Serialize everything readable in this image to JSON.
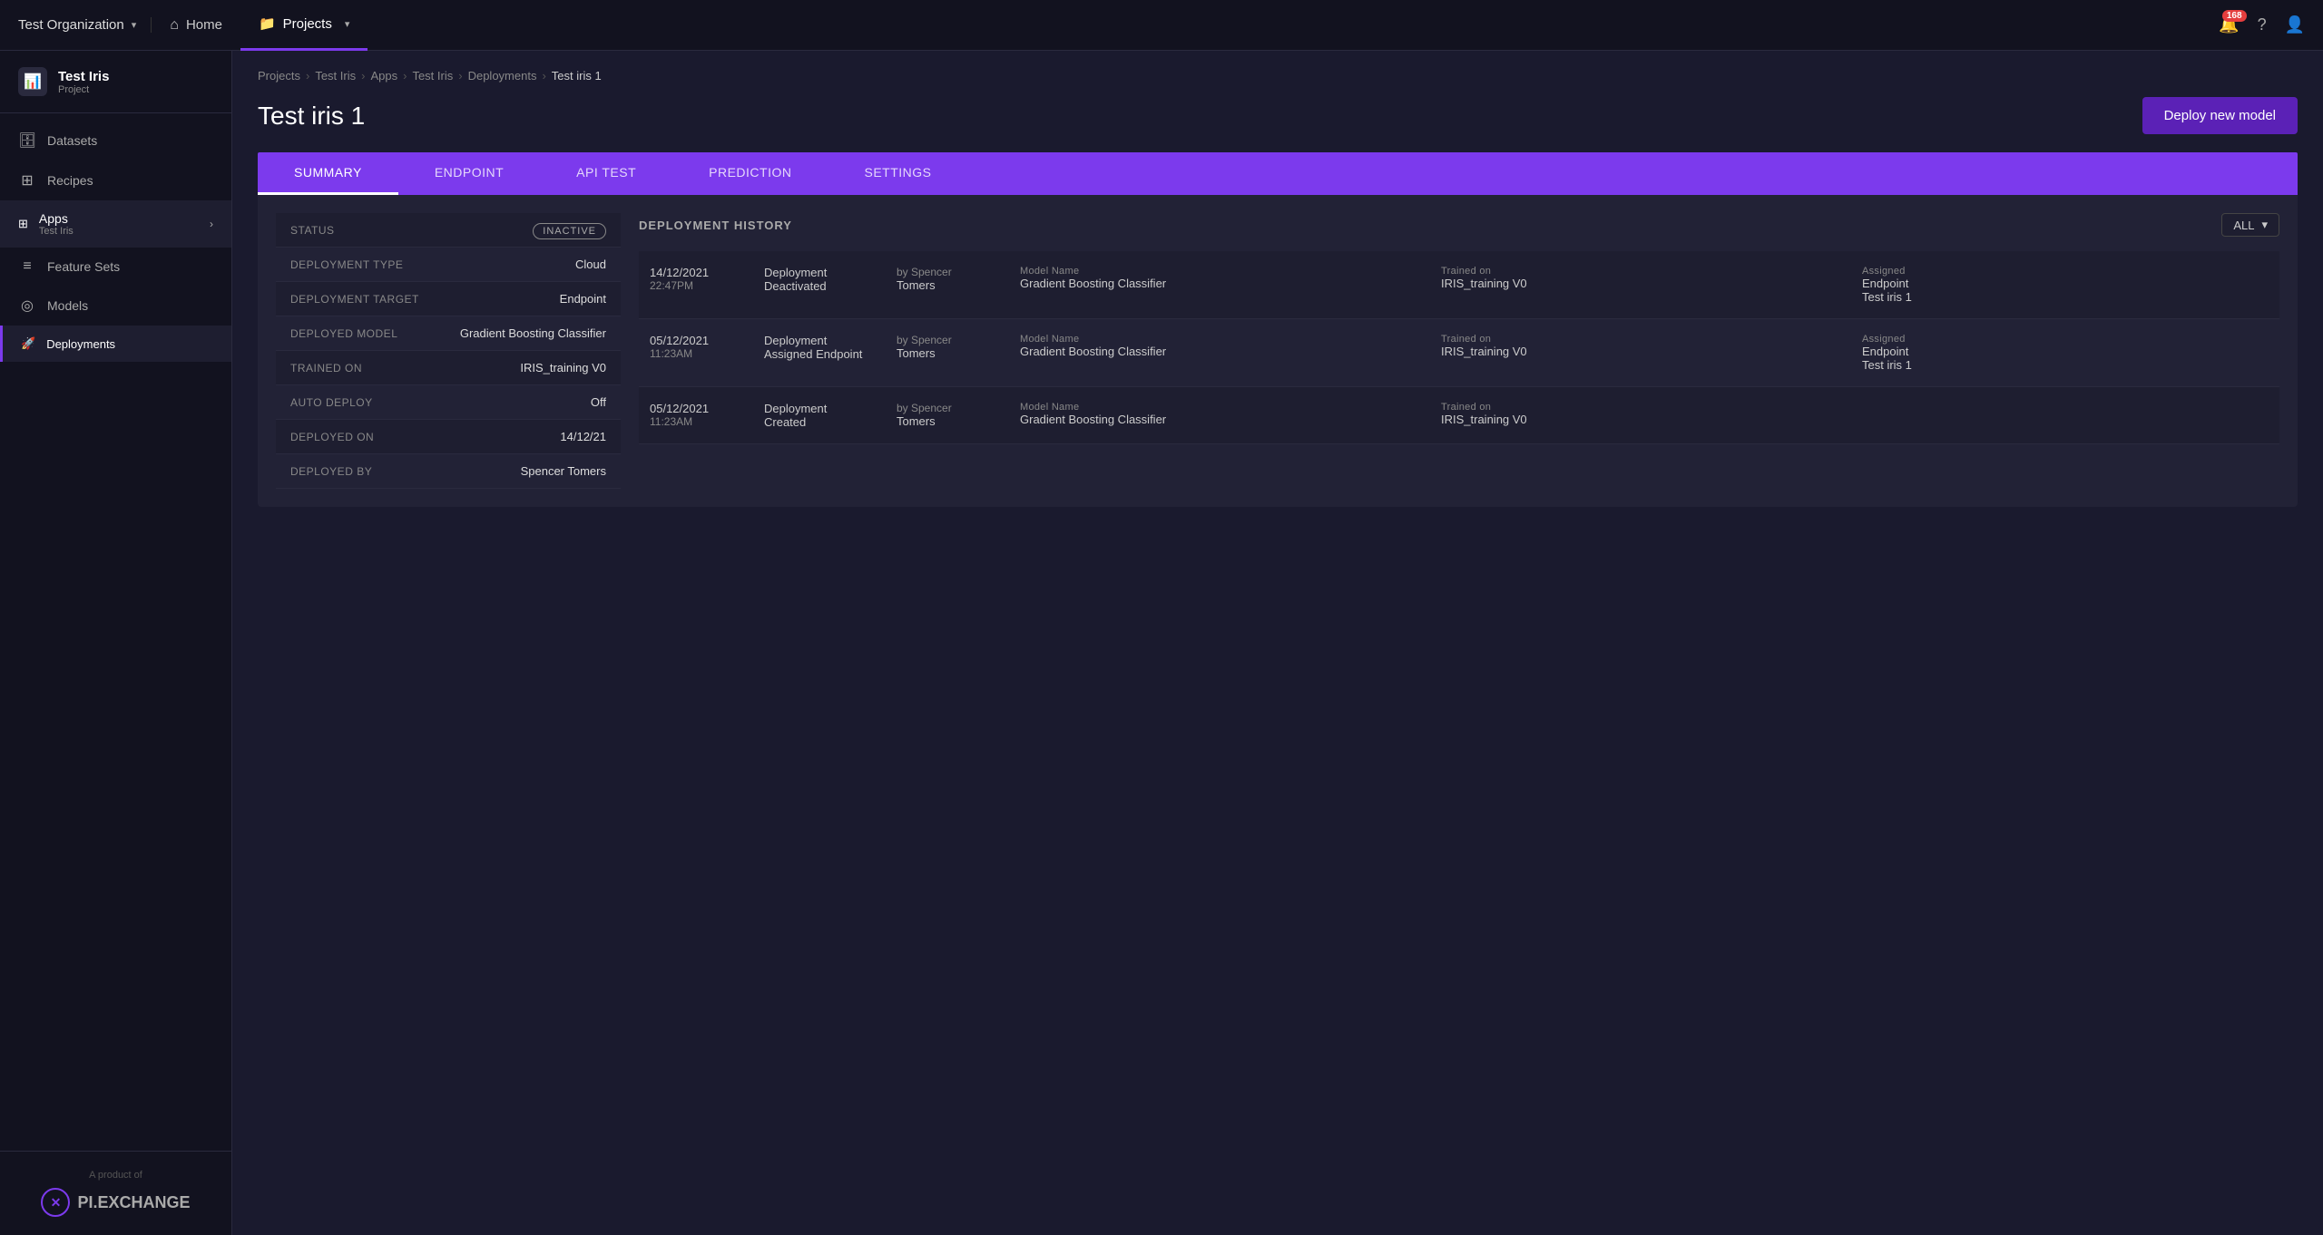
{
  "topNav": {
    "orgName": "Test Organization",
    "homeLabel": "Home",
    "projectsLabel": "Projects",
    "notifCount": "168",
    "chevronDown": "▾"
  },
  "sidebar": {
    "projectName": "Test Iris",
    "projectType": "Project",
    "datasetsLabel": "Datasets",
    "recipesLabel": "Recipes",
    "appsLabel": "Apps",
    "appsSub": "Test Iris",
    "featureSetsLabel": "Feature Sets",
    "modelsLabel": "Models",
    "deploymentsLabel": "Deployments",
    "footerText": "A product of",
    "logoText": "PI.EXCHANGE"
  },
  "breadcrumb": {
    "projects": "Projects",
    "testIris": "Test Iris",
    "apps": "Apps",
    "testIris2": "Test Iris",
    "deployments": "Deployments",
    "current": "Test iris 1"
  },
  "page": {
    "title": "Test iris 1",
    "deployBtnLabel": "Deploy new model"
  },
  "tabs": [
    {
      "id": "summary",
      "label": "SUMMARY",
      "active": true
    },
    {
      "id": "endpoint",
      "label": "ENDPOINT",
      "active": false
    },
    {
      "id": "apitest",
      "label": "API TEST",
      "active": false
    },
    {
      "id": "prediction",
      "label": "PREDICTION",
      "active": false
    },
    {
      "id": "settings",
      "label": "SETTINGS",
      "active": false
    }
  ],
  "summary": {
    "rows": [
      {
        "label": "STATUS",
        "value": "INACTIVE",
        "isStatus": true
      },
      {
        "label": "DEPLOYMENT TYPE",
        "value": "Cloud"
      },
      {
        "label": "DEPLOYMENT TARGET",
        "value": "Endpoint"
      },
      {
        "label": "DEPLOYED MODEL",
        "value": "Gradient Boosting Classifier"
      },
      {
        "label": "TRAINED ON",
        "value": "IRIS_training V0"
      },
      {
        "label": "AUTO DEPLOY",
        "value": "Off"
      },
      {
        "label": "DEPLOYED ON",
        "value": "14/12/21"
      },
      {
        "label": "DEPLOYED BY",
        "value": "Spencer Tomers"
      }
    ]
  },
  "history": {
    "title": "DEPLOYMENT HISTORY",
    "filterLabel": "ALL",
    "rows": [
      {
        "date": "14/12/2021",
        "time": "22:47PM",
        "action1": "Deployment",
        "action2": "Deactivated",
        "by1": "by Spencer",
        "by2": "Tomers",
        "modelLabel": "Model Name",
        "modelValue": "Gradient Boosting Classifier",
        "trainedLabel": "Trained on",
        "trainedValue": "IRIS_training V0",
        "assignedLabel": "Assigned",
        "assignedValue": "Endpoint",
        "assignedValue2": "Test iris 1"
      },
      {
        "date": "05/12/2021",
        "time": "11:23AM",
        "action1": "Deployment",
        "action2": "Assigned Endpoint",
        "by1": "by Spencer",
        "by2": "Tomers",
        "modelLabel": "Model Name",
        "modelValue": "Gradient Boosting Classifier",
        "trainedLabel": "Trained on",
        "trainedValue": "IRIS_training V0",
        "assignedLabel": "Assigned",
        "assignedValue": "Endpoint",
        "assignedValue2": "Test iris 1"
      },
      {
        "date": "05/12/2021",
        "time": "11:23AM",
        "action1": "Deployment",
        "action2": "Created",
        "by1": "by Spencer",
        "by2": "Tomers",
        "modelLabel": "Model Name",
        "modelValue": "Gradient Boosting Classifier",
        "trainedLabel": "Trained on",
        "trainedValue": "IRIS_training V0",
        "assignedLabel": "",
        "assignedValue": "",
        "assignedValue2": ""
      }
    ]
  }
}
